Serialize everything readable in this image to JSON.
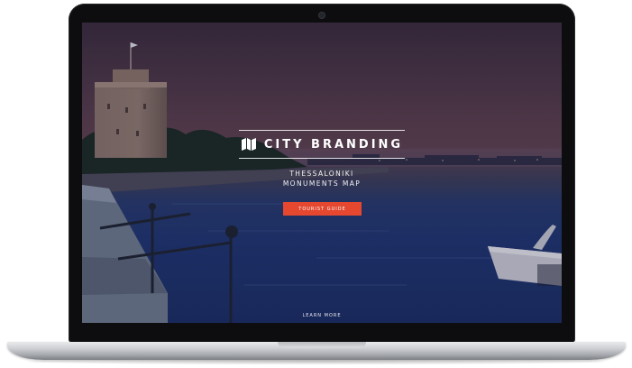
{
  "hero": {
    "brand_text": "CITY BRANDING",
    "subtitle_line1": "THESSALONIKI",
    "subtitle_line2": "MONUMENTS MAP",
    "cta_label": "TOURIST GUIDE",
    "learn_more_label": "LEARN MORE"
  },
  "icons": {
    "brand": "folded-map-icon"
  },
  "colors": {
    "cta_background": "#e5482f",
    "text": "#ffffff",
    "sky_top": "#3a2c3e",
    "sea": "#1e3572"
  }
}
